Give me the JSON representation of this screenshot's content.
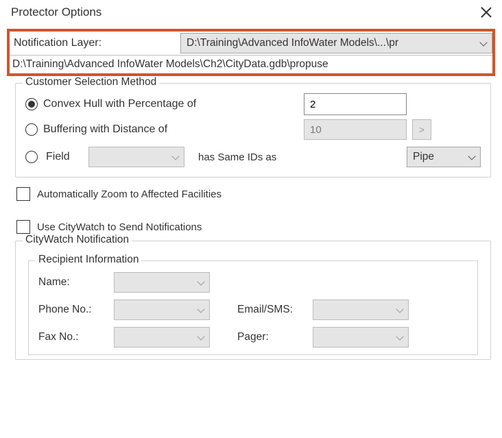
{
  "title": "Protector Options",
  "notification_layer": {
    "label": "Notification Layer:",
    "selected": "D:\\Training\\Advanced InfoWater Models\\...\\pr",
    "full_path": "D:\\Training\\Advanced InfoWater Models\\Ch2\\CityData.gdb\\propuse"
  },
  "csm": {
    "title": "Customer Selection Method",
    "opt1": {
      "label": "Convex Hull with Percentage of",
      "value": "2"
    },
    "opt2": {
      "label": "Buffering with Distance of",
      "value": "10",
      "gt": ">"
    },
    "opt3": {
      "label": "Field",
      "mid": "has Same IDs as",
      "combo_value": "Pipe"
    }
  },
  "auto_zoom_label": "Automatically Zoom to Affected Facilities",
  "citywatch_check_label": "Use CityWatch to Send Notifications",
  "cw": {
    "title": "CityWatch Notification",
    "recipient_title": "Recipient Information",
    "fields": {
      "name": "Name:",
      "phone": "Phone No.:",
      "fax": "Fax No.:",
      "email": "Email/SMS:",
      "pager": "Pager:"
    }
  }
}
